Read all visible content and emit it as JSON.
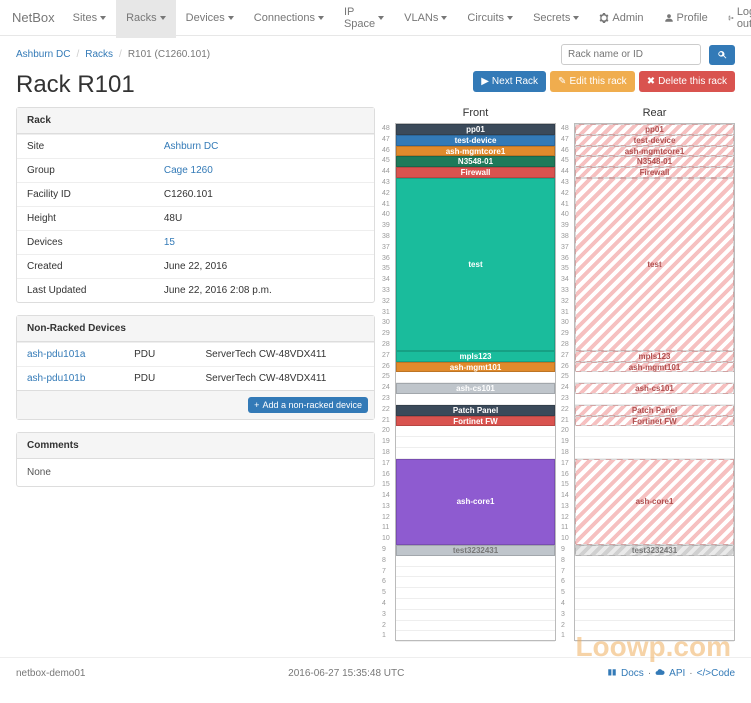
{
  "brand": "NetBox",
  "nav": [
    "Sites",
    "Racks",
    "Devices",
    "Connections",
    "IP Space",
    "VLANs",
    "Circuits",
    "Secrets"
  ],
  "navActive": 1,
  "navRight": {
    "admin": "Admin",
    "profile": "Profile",
    "logout": "Log out"
  },
  "breadcrumb": {
    "site": "Ashburn DC",
    "racks": "Racks",
    "current": "R101 (C1260.101)"
  },
  "search": {
    "placeholder": "Rack name or ID"
  },
  "actions": {
    "next": "Next Rack",
    "edit": "Edit this rack",
    "delete": "Delete this rack"
  },
  "title": "Rack R101",
  "panelRack": {
    "heading": "Rack",
    "rows": [
      {
        "k": "Site",
        "v": "Ashburn DC",
        "link": true
      },
      {
        "k": "Group",
        "v": "Cage 1260",
        "link": true
      },
      {
        "k": "Facility ID",
        "v": "C1260.101"
      },
      {
        "k": "Height",
        "v": "48U"
      },
      {
        "k": "Devices",
        "v": "15",
        "link": true
      },
      {
        "k": "Created",
        "v": "June 22, 2016"
      },
      {
        "k": "Last Updated",
        "v": "June 22, 2016 2:08 p.m."
      }
    ]
  },
  "panelNRD": {
    "heading": "Non-Racked Devices",
    "rows": [
      {
        "name": "ash-pdu101a",
        "type": "PDU",
        "model": "ServerTech CW-48VDX411"
      },
      {
        "name": "ash-pdu101b",
        "type": "PDU",
        "model": "ServerTech CW-48VDX411"
      }
    ],
    "add": "Add a non-racked device"
  },
  "panelComments": {
    "heading": "Comments",
    "body": "None"
  },
  "elev": {
    "front": "Front",
    "rear": "Rear",
    "height": 48,
    "devices": [
      {
        "name": "pp01",
        "u": 48,
        "span": 1,
        "color": "#3b4a5a"
      },
      {
        "name": "test-device",
        "u": 47,
        "span": 1,
        "color": "#337ab7"
      },
      {
        "name": "ash-mgmtcore1",
        "u": 46,
        "span": 1,
        "color": "#e08a2c"
      },
      {
        "name": "N3548-01",
        "u": 45,
        "span": 1,
        "color": "#1e7a5a"
      },
      {
        "name": "Firewall",
        "u": 44,
        "span": 1,
        "color": "#d9534f"
      },
      {
        "name": "test",
        "u": 28,
        "span": 16,
        "color": "#1abc9c"
      },
      {
        "name": "mpls123",
        "u": 27,
        "span": 1,
        "color": "#1abc9c"
      },
      {
        "name": "ash-mgmt101",
        "u": 26,
        "span": 1,
        "color": "#e08a2c"
      },
      {
        "name": "ash-cs101",
        "u": 24,
        "span": 1,
        "color": "#bfc5cb"
      },
      {
        "name": "Patch Panel",
        "u": 22,
        "span": 1,
        "color": "#3b4a5a"
      },
      {
        "name": "Fortinet FW",
        "u": 21,
        "span": 1,
        "color": "#d9534f"
      },
      {
        "name": "ash-core1",
        "u": 10,
        "span": 8,
        "color": "#8e5bd0"
      },
      {
        "name": "test3232431",
        "u": 9,
        "span": 1,
        "color": "#bfc5cb",
        "gray": true
      }
    ]
  },
  "footer": {
    "left": "netbox-demo01",
    "center": "2016-06-27 15:35:48 UTC",
    "docs": "Docs",
    "api": "API",
    "code": "Code"
  },
  "watermark": "Loowp.com"
}
